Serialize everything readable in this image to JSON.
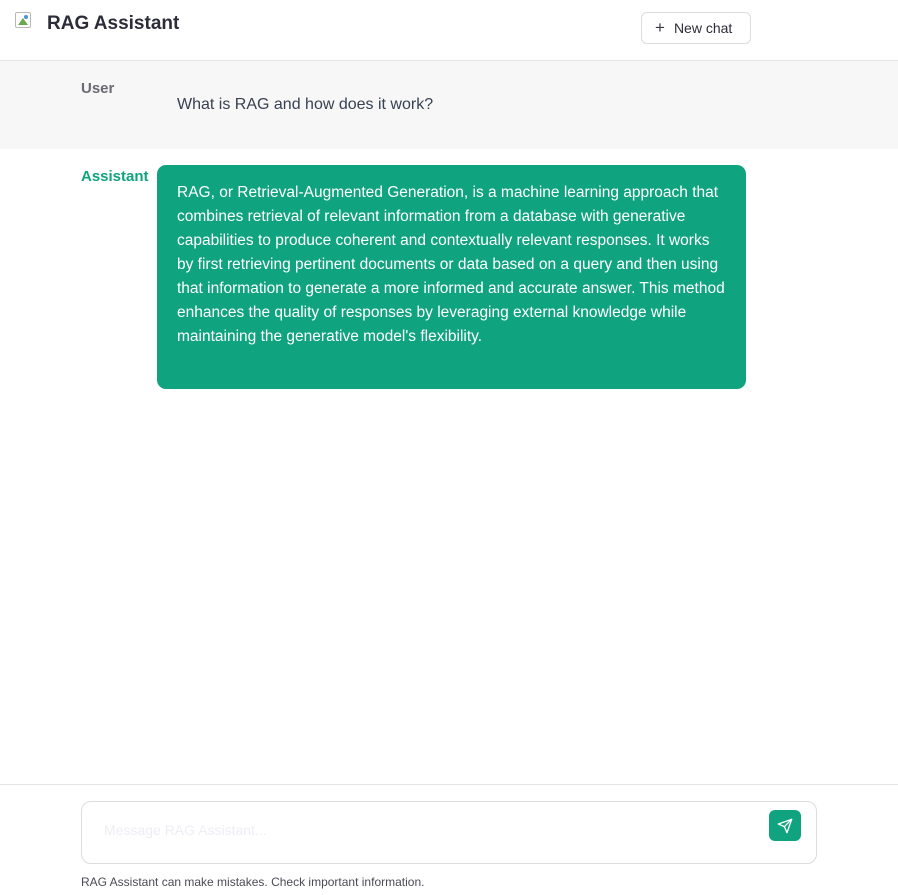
{
  "header": {
    "logo_icon": "broken-image-icon",
    "title": "RAG Assistant",
    "new_chat_icon": "plus-icon",
    "new_chat_plus": "+",
    "new_chat_label": "New chat"
  },
  "messages": [
    {
      "role": "User",
      "text": "What is RAG and how does it work?"
    },
    {
      "role": "Assistant",
      "text": "RAG, or Retrieval-Augmented Generation, is a machine learning approach that combines retrieval of relevant information from a database with generative capabilities to produce coherent and contextually relevant responses. It works by first retrieving pertinent documents or data based on a query and then using that information to generate a more informed and accurate answer. This method enhances the quality of responses by leveraging external knowledge while maintaining the generative model's flexibility."
    }
  ],
  "composer": {
    "placeholder": "Message RAG Assistant...",
    "value": "",
    "send_icon": "send-icon"
  },
  "footer": {
    "disclaimer": "RAG Assistant can make mistakes. Check important information."
  },
  "colors": {
    "accent": "#10a37f",
    "user_row_bg": "#f7f7f8",
    "assistant_bubble_text": "#ffffff"
  }
}
